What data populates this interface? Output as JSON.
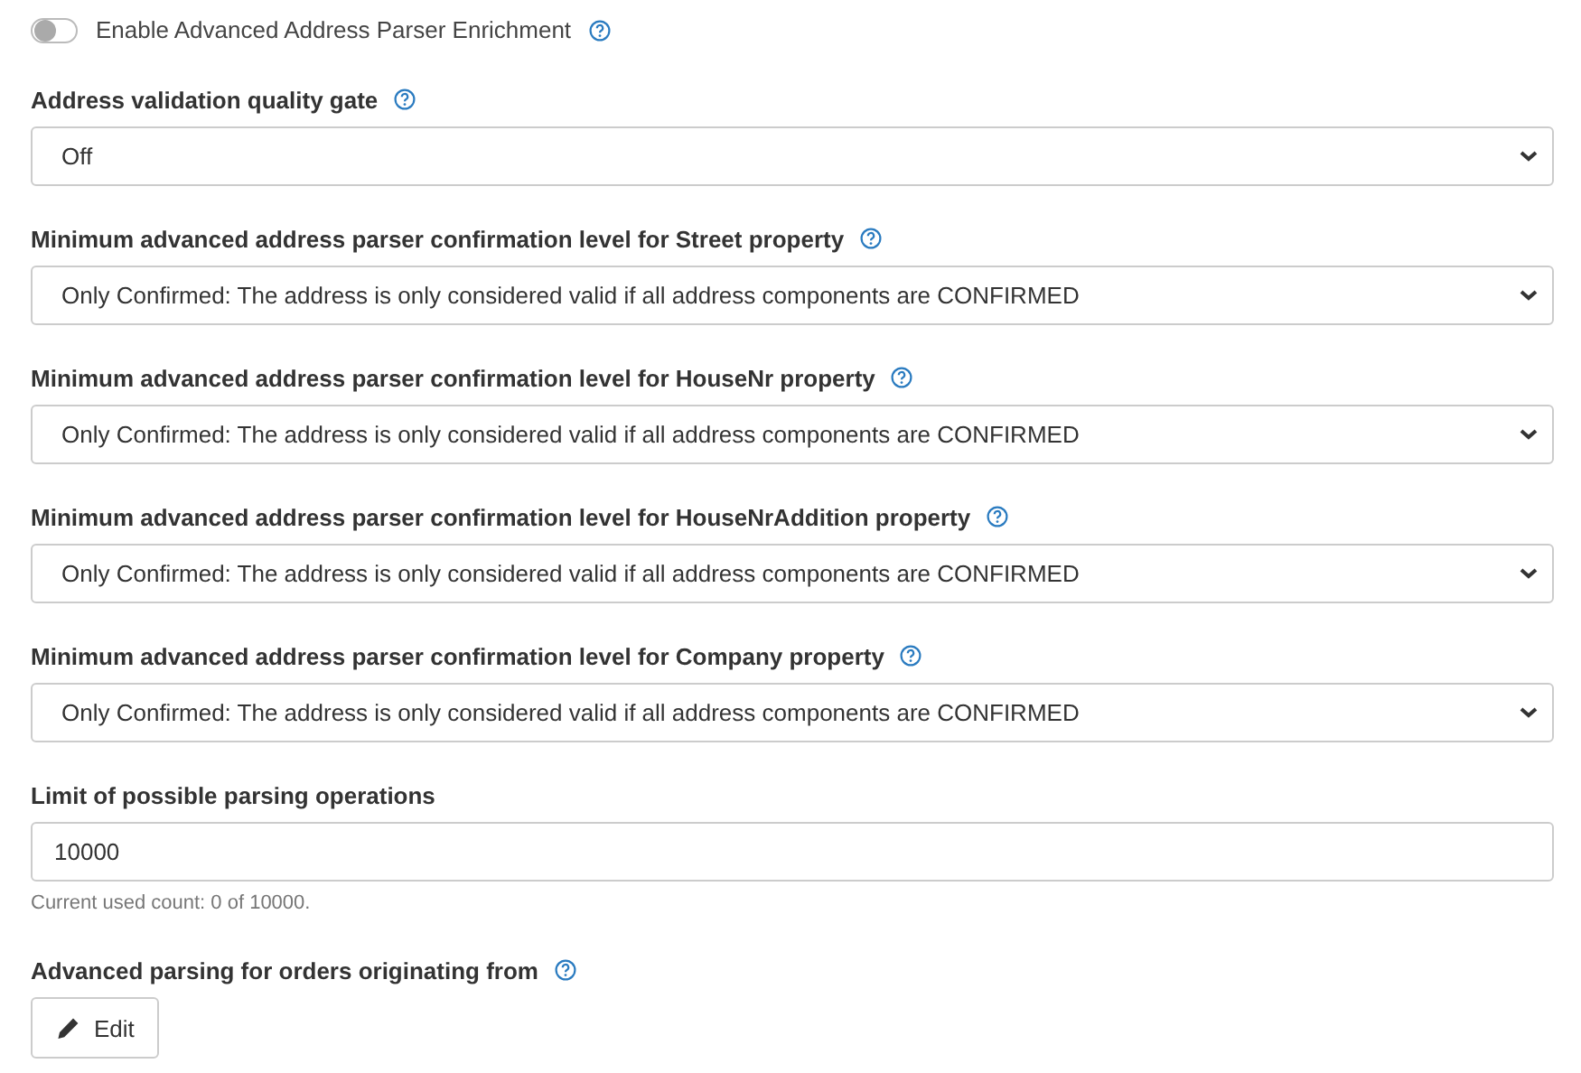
{
  "toggle": {
    "label": "Enable Advanced Address Parser Enrichment",
    "on": false,
    "help": true
  },
  "fields": [
    {
      "kind": "select",
      "label": "Address validation quality gate",
      "help": true,
      "value": "Off"
    },
    {
      "kind": "select",
      "label": "Minimum advanced address parser confirmation level for Street property",
      "help": true,
      "value": "Only Confirmed: The address is only considered valid if all address components are CONFIRMED"
    },
    {
      "kind": "select",
      "label": "Minimum advanced address parser confirmation level for HouseNr property",
      "help": true,
      "value": "Only Confirmed: The address is only considered valid if all address components are CONFIRMED"
    },
    {
      "kind": "select",
      "label": "Minimum advanced address parser confirmation level for HouseNrAddition property",
      "help": true,
      "value": "Only Confirmed: The address is only considered valid if all address components are CONFIRMED"
    },
    {
      "kind": "select",
      "label": "Minimum advanced address parser confirmation level for Company property",
      "help": true,
      "value": "Only Confirmed: The address is only considered valid if all address components are CONFIRMED"
    },
    {
      "kind": "input",
      "label": "Limit of possible parsing operations",
      "help": false,
      "value": "10000",
      "hint": "Current used count: 0 of 10000."
    },
    {
      "kind": "button",
      "label": "Advanced parsing for orders originating from",
      "help": true,
      "button": "Edit"
    }
  ]
}
